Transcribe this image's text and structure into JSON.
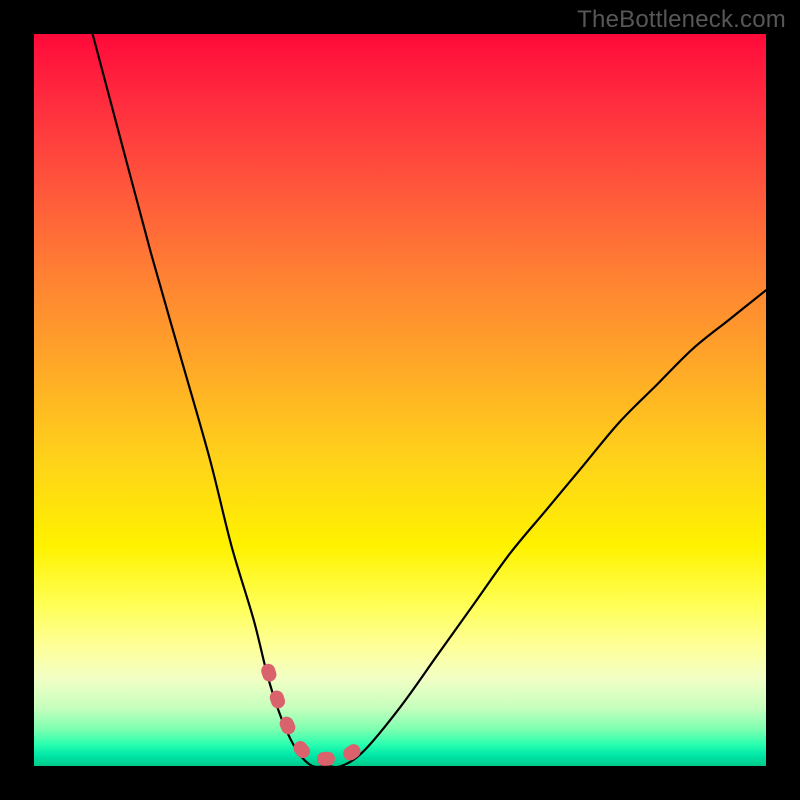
{
  "watermark": "TheBottleneck.com",
  "chart_data": {
    "type": "line",
    "title": "",
    "xlabel": "",
    "ylabel": "",
    "xlim": [
      0,
      100
    ],
    "ylim": [
      0,
      100
    ],
    "series": [
      {
        "name": "bottleneck-curve",
        "x": [
          8,
          12,
          16,
          20,
          24,
          27,
          30,
          32,
          34,
          36,
          38,
          40,
          42,
          45,
          50,
          55,
          60,
          65,
          70,
          75,
          80,
          85,
          90,
          95,
          100
        ],
        "y": [
          100,
          85,
          70,
          56,
          42,
          30,
          20,
          12,
          6,
          2,
          0,
          0,
          0,
          2,
          8,
          15,
          22,
          29,
          35,
          41,
          47,
          52,
          57,
          61,
          65
        ]
      }
    ],
    "annotations": [
      {
        "name": "valley-highlight",
        "type": "dashed-arc",
        "color": "#d9626c",
        "x_range": [
          31,
          46
        ],
        "y_range": [
          0,
          11
        ]
      }
    ],
    "gradient_stops": [
      {
        "pos": 0.0,
        "color": "#ff0a3a"
      },
      {
        "pos": 0.1,
        "color": "#ff2f3f"
      },
      {
        "pos": 0.22,
        "color": "#ff5a3b"
      },
      {
        "pos": 0.34,
        "color": "#ff8432"
      },
      {
        "pos": 0.45,
        "color": "#ffa728"
      },
      {
        "pos": 0.58,
        "color": "#ffd21a"
      },
      {
        "pos": 0.7,
        "color": "#fff200"
      },
      {
        "pos": 0.78,
        "color": "#ffff56"
      },
      {
        "pos": 0.84,
        "color": "#fdff9c"
      },
      {
        "pos": 0.88,
        "color": "#f2ffc4"
      },
      {
        "pos": 0.92,
        "color": "#c7ffbe"
      },
      {
        "pos": 0.95,
        "color": "#7dffb0"
      },
      {
        "pos": 0.97,
        "color": "#2cffb0"
      },
      {
        "pos": 0.985,
        "color": "#00e8a8"
      },
      {
        "pos": 1.0,
        "color": "#00c989"
      }
    ]
  }
}
